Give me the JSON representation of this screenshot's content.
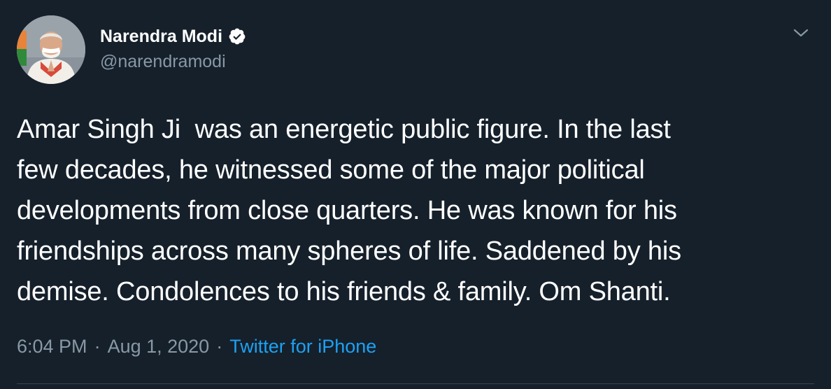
{
  "tweet": {
    "author": {
      "display_name": "Narendra Modi",
      "handle": "@narendramodi",
      "verified": true,
      "avatar_icon": "profile-photo"
    },
    "text": "Amar Singh Ji  was an energetic public figure. In the last\nfew decades, he witnessed some of the major political\ndevelopments from close quarters. He was known for his\nfriendships across many spheres of life. Saddened by his\ndemise. Condolences to his friends & family. Om Shanti.",
    "time": "6:04 PM",
    "separator": "·",
    "date": "Aug 1, 2020",
    "source": "Twitter for iPhone"
  },
  "colors": {
    "background": "#15202b",
    "text": "#ffffff",
    "secondary": "#8899a6",
    "link": "#1da1f2",
    "verified_badge": "#ffffff",
    "divider": "#38444d"
  },
  "icons": {
    "verified": "verified-badge-icon",
    "more": "chevron-down-icon"
  }
}
